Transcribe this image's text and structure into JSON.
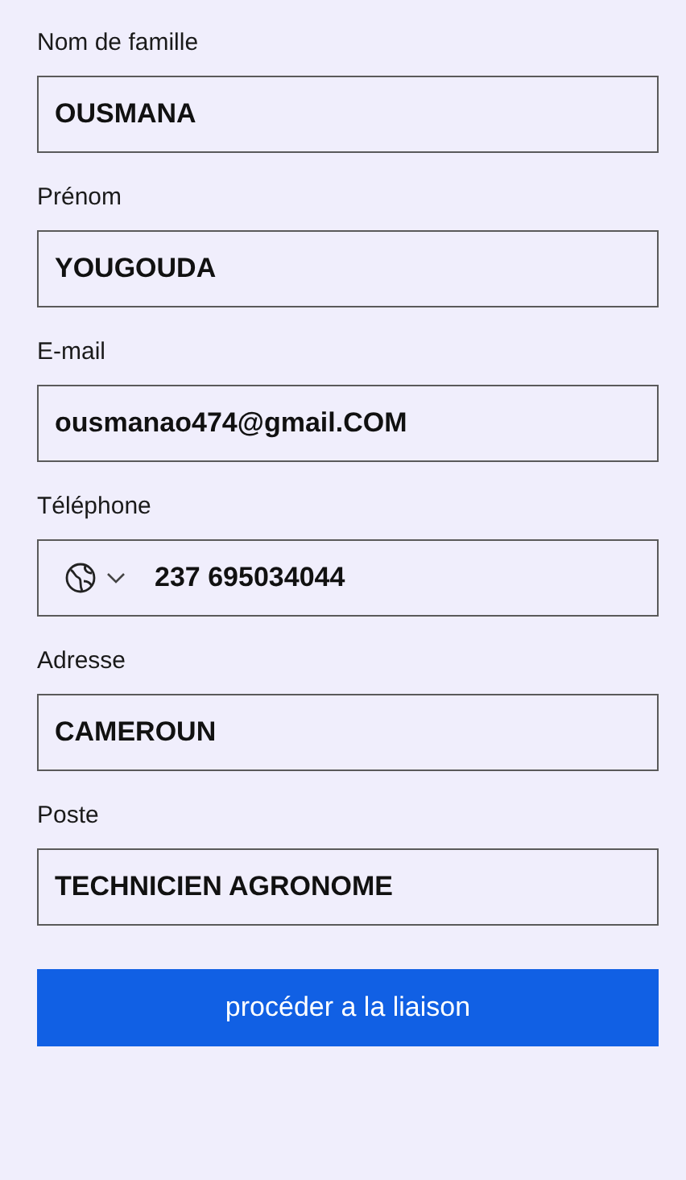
{
  "fields": [
    {
      "kind": "text",
      "label": "Nom de famille",
      "value": "OUSMANA"
    },
    {
      "kind": "text",
      "label": "Prénom",
      "value": "YOUGOUDA"
    },
    {
      "kind": "text",
      "label": "E-mail",
      "value": "ousmanao474@gmail.COM"
    },
    {
      "kind": "phone",
      "label": "Téléphone",
      "value": "237 695034044"
    },
    {
      "kind": "text",
      "label": "Adresse",
      "value": "CAMEROUN"
    },
    {
      "kind": "text",
      "label": "Poste",
      "value": "TECHNICIEN AGRONOME"
    }
  ],
  "submit": {
    "label": "procéder a la liaison"
  }
}
